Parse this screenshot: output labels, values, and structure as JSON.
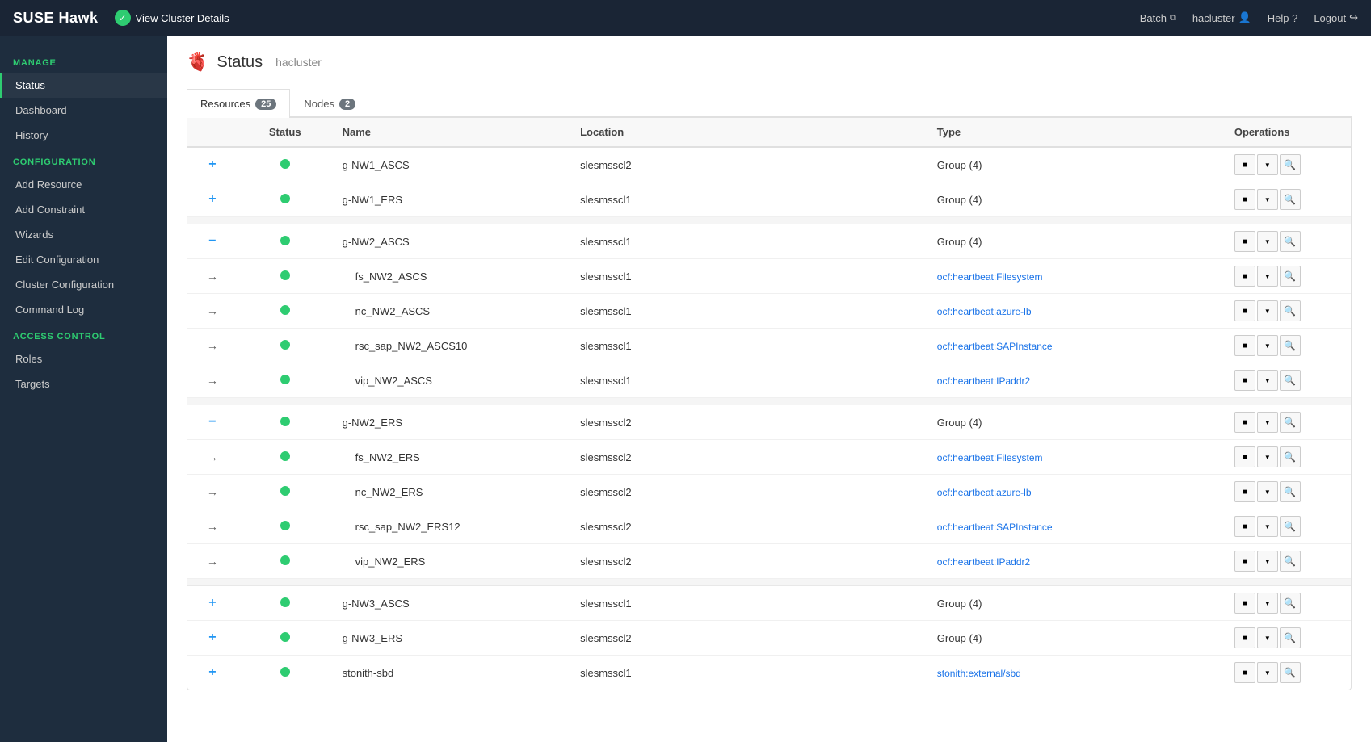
{
  "brand": "SUSE Hawk",
  "topnav": {
    "view_cluster_label": "View Cluster Details",
    "batch_label": "Batch",
    "cluster_label": "hacluster",
    "help_label": "Help ?",
    "logout_label": "Logout"
  },
  "sidebar": {
    "manage_label": "MANAGE",
    "config_label": "CONFIGURATION",
    "access_label": "ACCESS CONTROL",
    "manage_items": [
      {
        "label": "Status",
        "active": true
      },
      {
        "label": "Dashboard"
      },
      {
        "label": "History"
      }
    ],
    "config_items": [
      {
        "label": "Add Resource"
      },
      {
        "label": "Add Constraint"
      },
      {
        "label": "Wizards"
      },
      {
        "label": "Edit Configuration"
      },
      {
        "label": "Cluster Configuration"
      },
      {
        "label": "Command Log"
      }
    ],
    "access_items": [
      {
        "label": "Roles"
      },
      {
        "label": "Targets"
      }
    ]
  },
  "page": {
    "title": "Status",
    "cluster": "hacluster"
  },
  "tabs": [
    {
      "label": "Resources",
      "badge": "25",
      "active": true
    },
    {
      "label": "Nodes",
      "badge": "2"
    }
  ],
  "table": {
    "headers": [
      "",
      "Status",
      "Name",
      "Location",
      "Type",
      "Operations"
    ],
    "rows": [
      {
        "expand": "+",
        "expand_type": "plus",
        "status": "green",
        "name": "g-NW1_ASCS",
        "location": "slesmsscl2",
        "type": "Group (4)",
        "type_link": false,
        "indent": false
      },
      {
        "expand": "+",
        "expand_type": "plus",
        "status": "green",
        "name": "g-NW1_ERS",
        "location": "slesmsscl1",
        "type": "Group (4)",
        "type_link": false,
        "indent": false
      },
      {
        "expand": "−",
        "expand_type": "minus",
        "status": "green",
        "name": "g-NW2_ASCS",
        "location": "slesmsscl1",
        "type": "Group (4)",
        "type_link": false,
        "indent": false,
        "separator_before": true
      },
      {
        "expand": "→",
        "expand_type": "arrow",
        "status": "green",
        "name": "fs_NW2_ASCS",
        "location": "slesmsscl1",
        "type": "ocf:heartbeat:Filesystem",
        "type_link": true,
        "indent": true
      },
      {
        "expand": "→",
        "expand_type": "arrow",
        "status": "green",
        "name": "nc_NW2_ASCS",
        "location": "slesmsscl1",
        "type": "ocf:heartbeat:azure-lb",
        "type_link": true,
        "indent": true
      },
      {
        "expand": "→",
        "expand_type": "arrow",
        "status": "green",
        "name": "rsc_sap_NW2_ASCS10",
        "location": "slesmsscl1",
        "type": "ocf:heartbeat:SAPInstance",
        "type_link": true,
        "indent": true
      },
      {
        "expand": "→",
        "expand_type": "arrow",
        "status": "green",
        "name": "vip_NW2_ASCS",
        "location": "slesmsscl1",
        "type": "ocf:heartbeat:IPaddr2",
        "type_link": true,
        "indent": true
      },
      {
        "expand": "−",
        "expand_type": "minus",
        "status": "green",
        "name": "g-NW2_ERS",
        "location": "slesmsscl2",
        "type": "Group (4)",
        "type_link": false,
        "indent": false,
        "separator_before": true
      },
      {
        "expand": "→",
        "expand_type": "arrow",
        "status": "green",
        "name": "fs_NW2_ERS",
        "location": "slesmsscl2",
        "type": "ocf:heartbeat:Filesystem",
        "type_link": true,
        "indent": true
      },
      {
        "expand": "→",
        "expand_type": "arrow",
        "status": "green",
        "name": "nc_NW2_ERS",
        "location": "slesmsscl2",
        "type": "ocf:heartbeat:azure-lb",
        "type_link": true,
        "indent": true
      },
      {
        "expand": "→",
        "expand_type": "arrow",
        "status": "green",
        "name": "rsc_sap_NW2_ERS12",
        "location": "slesmsscl2",
        "type": "ocf:heartbeat:SAPInstance",
        "type_link": true,
        "indent": true
      },
      {
        "expand": "→",
        "expand_type": "arrow",
        "status": "green",
        "name": "vip_NW2_ERS",
        "location": "slesmsscl2",
        "type": "ocf:heartbeat:IPaddr2",
        "type_link": true,
        "indent": true
      },
      {
        "expand": "+",
        "expand_type": "plus",
        "status": "green",
        "name": "g-NW3_ASCS",
        "location": "slesmsscl1",
        "type": "Group (4)",
        "type_link": false,
        "indent": false,
        "separator_before": true
      },
      {
        "expand": "+",
        "expand_type": "plus",
        "status": "green",
        "name": "g-NW3_ERS",
        "location": "slesmsscl2",
        "type": "Group (4)",
        "type_link": false,
        "indent": false
      },
      {
        "expand": "+",
        "expand_type": "plus",
        "status": "green",
        "name": "stonith-sbd",
        "location": "slesmsscl1",
        "type": "stonith:external/sbd",
        "type_link": true,
        "indent": false
      }
    ]
  }
}
